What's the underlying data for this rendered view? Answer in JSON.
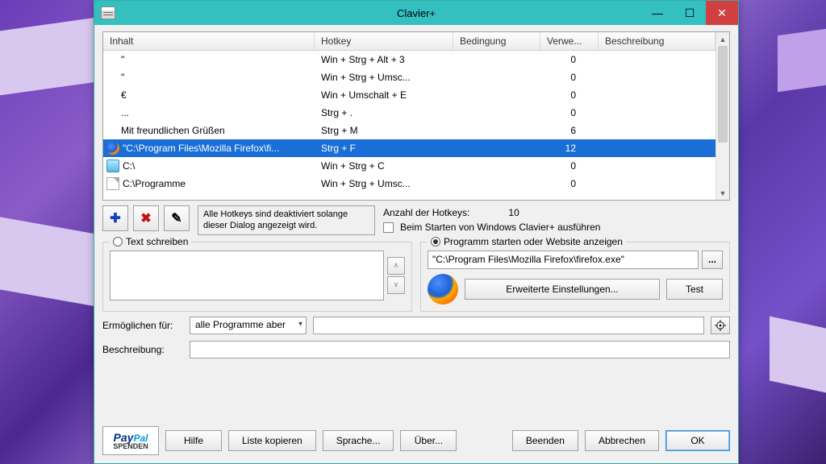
{
  "title": "Clavier+",
  "headers": {
    "inhalt": "Inhalt",
    "hotkey": "Hotkey",
    "bedingung": "Bedingung",
    "verwe": "Verwe...",
    "beschreibung": "Beschreibung"
  },
  "rows": [
    {
      "inhalt": "\"",
      "hotkey": "Win + Strg + Alt + 3",
      "ver": "0"
    },
    {
      "inhalt": "\"",
      "hotkey": "Win + Strg + Umsc...",
      "ver": "0"
    },
    {
      "inhalt": "€",
      "hotkey": "Win + Umschalt + E",
      "ver": "0"
    },
    {
      "inhalt": "...",
      "hotkey": "Strg + .",
      "ver": "0"
    },
    {
      "inhalt": "Mit freundlichen Grüßen",
      "hotkey": "Strg + M",
      "ver": "6"
    },
    {
      "inhalt": "\"C:\\Program Files\\Mozilla Firefox\\fi...",
      "hotkey": "Strg + F",
      "ver": "12",
      "icon": "ff",
      "sel": true
    },
    {
      "inhalt": "C:\\",
      "hotkey": "Win + Strg + C",
      "ver": "0",
      "icon": "drv"
    },
    {
      "inhalt": "C:\\Programme",
      "hotkey": "Win + Strg + Umsc...",
      "ver": "0",
      "icon": "doc"
    }
  ],
  "note": "Alle Hotkeys sind deaktiviert solange dieser Dialog angezeigt wird.",
  "count_label": "Anzahl der Hotkeys:",
  "count": "10",
  "autostart": "Beim Starten von Windows Clavier+ ausführen",
  "radio_text": "Text schreiben",
  "radio_prog": "Programm starten oder Website anzeigen",
  "path": "\"C:\\Program Files\\Mozilla Firefox\\firefox.exe\"",
  "adv": "Erweiterte Einstellungen...",
  "test": "Test",
  "enable_for": "Ermöglichen für:",
  "combo_val": "alle Programme aber",
  "desc_label": "Beschreibung:",
  "paypal": {
    "brand": "PayPal",
    "sub": "SPENDEN"
  },
  "btns": {
    "hilfe": "Hilfe",
    "liste": "Liste kopieren",
    "sprache": "Sprache...",
    "uber": "Über...",
    "beenden": "Beenden",
    "abbrechen": "Abbrechen",
    "ok": "OK"
  }
}
